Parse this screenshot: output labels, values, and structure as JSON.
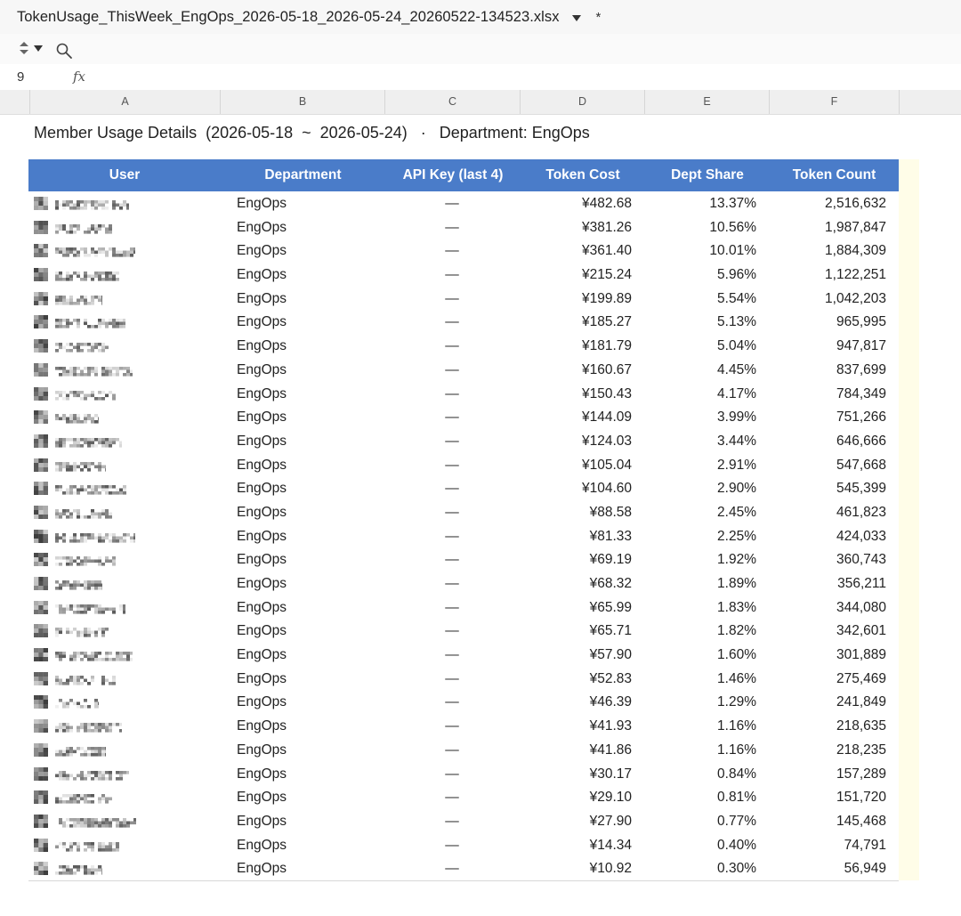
{
  "window": {
    "filename": "TokenUsage_ThisWeek_EngOps_2026-05-18_2026-05-24_20260522-134523.xlsx",
    "modified_marker": "*"
  },
  "formula_bar": {
    "cell_ref": "9",
    "fx_label": "fx"
  },
  "columns": [
    "A",
    "B",
    "C",
    "D",
    "E",
    "F"
  ],
  "report": {
    "title": "Member Usage Details  (2026-05-18  ~  2026-05-24)   ·   Department: EngOps"
  },
  "table": {
    "headers": {
      "user": "User",
      "department": "Department",
      "api_key": "API Key (last 4)",
      "token_cost": "Token Cost",
      "dept_share": "Dept Share",
      "token_count": "Token Count"
    },
    "rows": [
      {
        "department": "EngOps",
        "api_key": "—",
        "token_cost": "¥482.68",
        "dept_share": "13.37%",
        "token_count": "2,516,632"
      },
      {
        "department": "EngOps",
        "api_key": "—",
        "token_cost": "¥381.26",
        "dept_share": "10.56%",
        "token_count": "1,987,847"
      },
      {
        "department": "EngOps",
        "api_key": "—",
        "token_cost": "¥361.40",
        "dept_share": "10.01%",
        "token_count": "1,884,309"
      },
      {
        "department": "EngOps",
        "api_key": "—",
        "token_cost": "¥215.24",
        "dept_share": "5.96%",
        "token_count": "1,122,251"
      },
      {
        "department": "EngOps",
        "api_key": "—",
        "token_cost": "¥199.89",
        "dept_share": "5.54%",
        "token_count": "1,042,203"
      },
      {
        "department": "EngOps",
        "api_key": "—",
        "token_cost": "¥185.27",
        "dept_share": "5.13%",
        "token_count": "965,995"
      },
      {
        "department": "EngOps",
        "api_key": "—",
        "token_cost": "¥181.79",
        "dept_share": "5.04%",
        "token_count": "947,817"
      },
      {
        "department": "EngOps",
        "api_key": "—",
        "token_cost": "¥160.67",
        "dept_share": "4.45%",
        "token_count": "837,699"
      },
      {
        "department": "EngOps",
        "api_key": "—",
        "token_cost": "¥150.43",
        "dept_share": "4.17%",
        "token_count": "784,349"
      },
      {
        "department": "EngOps",
        "api_key": "—",
        "token_cost": "¥144.09",
        "dept_share": "3.99%",
        "token_count": "751,266"
      },
      {
        "department": "EngOps",
        "api_key": "—",
        "token_cost": "¥124.03",
        "dept_share": "3.44%",
        "token_count": "646,666"
      },
      {
        "department": "EngOps",
        "api_key": "—",
        "token_cost": "¥105.04",
        "dept_share": "2.91%",
        "token_count": "547,668"
      },
      {
        "department": "EngOps",
        "api_key": "—",
        "token_cost": "¥104.60",
        "dept_share": "2.90%",
        "token_count": "545,399"
      },
      {
        "department": "EngOps",
        "api_key": "—",
        "token_cost": "¥88.58",
        "dept_share": "2.45%",
        "token_count": "461,823"
      },
      {
        "department": "EngOps",
        "api_key": "—",
        "token_cost": "¥81.33",
        "dept_share": "2.25%",
        "token_count": "424,033"
      },
      {
        "department": "EngOps",
        "api_key": "—",
        "token_cost": "¥69.19",
        "dept_share": "1.92%",
        "token_count": "360,743"
      },
      {
        "department": "EngOps",
        "api_key": "—",
        "token_cost": "¥68.32",
        "dept_share": "1.89%",
        "token_count": "356,211"
      },
      {
        "department": "EngOps",
        "api_key": "—",
        "token_cost": "¥65.99",
        "dept_share": "1.83%",
        "token_count": "344,080"
      },
      {
        "department": "EngOps",
        "api_key": "—",
        "token_cost": "¥65.71",
        "dept_share": "1.82%",
        "token_count": "342,601"
      },
      {
        "department": "EngOps",
        "api_key": "—",
        "token_cost": "¥57.90",
        "dept_share": "1.60%",
        "token_count": "301,889"
      },
      {
        "department": "EngOps",
        "api_key": "—",
        "token_cost": "¥52.83",
        "dept_share": "1.46%",
        "token_count": "275,469"
      },
      {
        "department": "EngOps",
        "api_key": "—",
        "token_cost": "¥46.39",
        "dept_share": "1.29%",
        "token_count": "241,849"
      },
      {
        "department": "EngOps",
        "api_key": "—",
        "token_cost": "¥41.93",
        "dept_share": "1.16%",
        "token_count": "218,635"
      },
      {
        "department": "EngOps",
        "api_key": "—",
        "token_cost": "¥41.86",
        "dept_share": "1.16%",
        "token_count": "218,235"
      },
      {
        "department": "EngOps",
        "api_key": "—",
        "token_cost": "¥30.17",
        "dept_share": "0.84%",
        "token_count": "157,289"
      },
      {
        "department": "EngOps",
        "api_key": "—",
        "token_cost": "¥29.10",
        "dept_share": "0.81%",
        "token_count": "151,720"
      },
      {
        "department": "EngOps",
        "api_key": "—",
        "token_cost": "¥27.90",
        "dept_share": "0.77%",
        "token_count": "145,468"
      },
      {
        "department": "EngOps",
        "api_key": "—",
        "token_cost": "¥14.34",
        "dept_share": "0.40%",
        "token_count": "74,791"
      },
      {
        "department": "EngOps",
        "api_key": "—",
        "token_cost": "¥10.92",
        "dept_share": "0.30%",
        "token_count": "56,949"
      }
    ]
  },
  "colors": {
    "header_bg": "#4a7cc9",
    "header_text": "#ffffff",
    "titlebar_bg": "#f7f7f7",
    "colheader_bg": "#efefef",
    "strip": "#fffde8"
  },
  "icons": {
    "sort": "sort-updown-icon",
    "sort_dropdown": "chevron-down-icon",
    "search": "search-icon",
    "file_dropdown": "chevron-down-icon"
  }
}
